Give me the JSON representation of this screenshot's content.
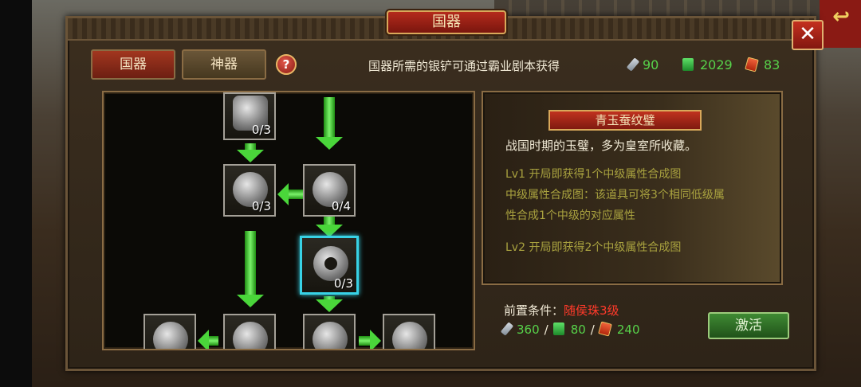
{
  "header": {
    "title": "国器",
    "close_label": "✕"
  },
  "tabs": [
    {
      "label": "国器",
      "active": true
    },
    {
      "label": "神器",
      "active": false
    }
  ],
  "help_label": "?",
  "info_text": "国器所需的银铲可通过霸业剧本获得",
  "currencies": [
    {
      "icon": "silver-shovel-icon",
      "value": "90"
    },
    {
      "icon": "jade-icon",
      "value": "2029"
    },
    {
      "icon": "red-token-icon",
      "value": "83"
    }
  ],
  "tree": {
    "nodes": [
      {
        "icon": "jade-plaque-icon",
        "count": "0/3"
      },
      {
        "icon": "armillary-sphere-icon",
        "count": "0/3"
      },
      {
        "icon": "crystal-orb-icon",
        "count": "0/4"
      },
      {
        "icon": "jade-bi-disc-icon",
        "count": "0/3",
        "selected": true
      },
      {
        "icon": "jade-dragon-icon",
        "count": ""
      },
      {
        "icon": "bronze-plate-icon",
        "count": ""
      },
      {
        "icon": "hourglass-icon",
        "count": ""
      },
      {
        "icon": "carved-disc-icon",
        "count": ""
      }
    ]
  },
  "detail": {
    "title": "青玉蚕纹璧",
    "description": "战国时期的玉璧，多为皇室所收藏。",
    "lines": [
      "Lv1 开局即获得1个中级属性合成图",
      "中级属性合成图：该道具可将3个相同低级属",
      "性合成1个中级的对应属性",
      "Lv2 开局即获得2个中级属性合成图"
    ]
  },
  "prerequisite": {
    "label": "前置条件：",
    "value": "随侯珠3级"
  },
  "cost": [
    {
      "icon": "silver-shovel-icon",
      "value": "360"
    },
    {
      "icon": "jade-icon",
      "value": "80"
    },
    {
      "icon": "red-token-icon",
      "value": "240"
    }
  ],
  "cost_separator": "/",
  "activate_label": "激活",
  "colors": {
    "accent_red": "#a2361f",
    "green_text": "#57d24a",
    "warning_red": "#ff3a2a",
    "olive_text": "#a9a23f",
    "selected_border": "#38d2e6"
  }
}
